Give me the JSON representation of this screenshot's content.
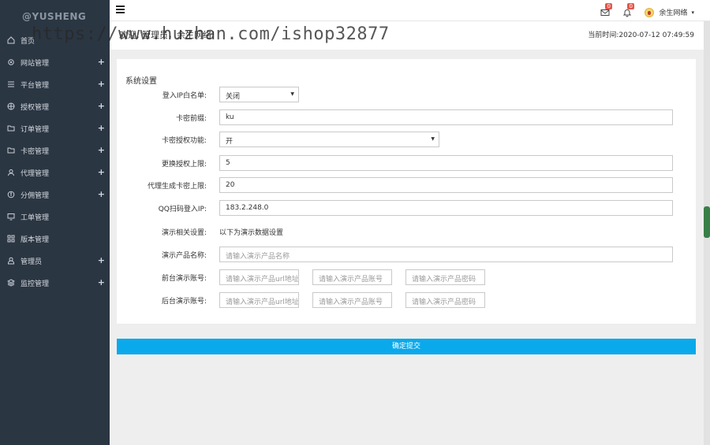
{
  "brand": "@YUSHENG",
  "sidebar": {
    "items": [
      {
        "label": "首页",
        "icon": "home-icon",
        "has_plus": false
      },
      {
        "label": "网站管理",
        "icon": "gear-icon",
        "has_plus": true
      },
      {
        "label": "平台管理",
        "icon": "list-icon",
        "has_plus": true
      },
      {
        "label": "授权管理",
        "icon": "grid-circle-icon",
        "has_plus": true
      },
      {
        "label": "订单管理",
        "icon": "folder-icon",
        "has_plus": true
      },
      {
        "label": "卡密管理",
        "icon": "folder-icon",
        "has_plus": true
      },
      {
        "label": "代理管理",
        "icon": "user-icon",
        "has_plus": true
      },
      {
        "label": "分佣管理",
        "icon": "coin-icon",
        "has_plus": true
      },
      {
        "label": "工单管理",
        "icon": "monitor-icon",
        "has_plus": false
      },
      {
        "label": "版本管理",
        "icon": "apps-icon",
        "has_plus": false
      },
      {
        "label": "管理员",
        "icon": "admin-icon",
        "has_plus": true
      },
      {
        "label": "监控管理",
        "icon": "layers-icon",
        "has_plus": true
      }
    ],
    "plus_symbol": "+"
  },
  "topbar": {
    "mail_badge": "0",
    "bell_badge": "0",
    "user_name": "余生网络",
    "caret": "▾"
  },
  "welcome": {
    "text": "欢迎, 管理员，余生网络!",
    "time_label": "当前时间:",
    "time_value": "2020-07-12 07:49:59"
  },
  "watermark": "https://www.huzhan.com/ishop32877",
  "form": {
    "title": "系统设置",
    "ip_whitelist_label": "登入IP白名单:",
    "ip_whitelist_value": "关闭",
    "card_prefix_label": "卡密前缀:",
    "card_prefix_value": "ku",
    "card_auth_label": "卡密授权功能:",
    "card_auth_value": "开",
    "change_limit_label": "更换授权上限:",
    "change_limit_value": "5",
    "agent_card_limit_label": "代理生成卡密上限:",
    "agent_card_limit_value": "20",
    "qq_ip_label": "QQ扫码登入IP:",
    "qq_ip_value": "183.2.248.0",
    "demo_settings_label": "演示相关设置:",
    "demo_settings_text": "以下为演示数据设置",
    "demo_product_label": "演示产品名称:",
    "demo_product_placeholder": "请输入演示产品名称",
    "front_demo_label": "前台演示账号:",
    "back_demo_label": "后台演示账号:",
    "url_placeholder": "请输入演示产品url地址",
    "account_placeholder": "请输入演示产品账号",
    "password_placeholder": "请输入演示产品密码",
    "submit_label": "确定提交"
  }
}
